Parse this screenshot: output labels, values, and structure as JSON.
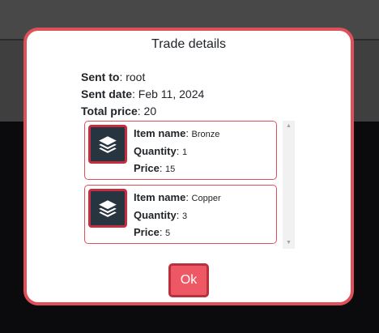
{
  "modal": {
    "title": "Trade details",
    "sent_to_label": "Sent to",
    "sent_to_value": "root",
    "sent_date_label": "Sent date",
    "sent_date_value": "Feb 11, 2024",
    "total_price_label": "Total price",
    "total_price_value": "20",
    "items": [
      {
        "name_label": "Item name",
        "name": "Bronze",
        "quantity_label": "Quantity",
        "quantity": "1",
        "price_label": "Price",
        "price": "15",
        "icon": "layers-icon"
      },
      {
        "name_label": "Item name",
        "name": "Copper",
        "quantity_label": "Quantity",
        "quantity": "3",
        "price_label": "Price",
        "price": "5",
        "icon": "layers-icon"
      }
    ],
    "ok_label": "Ok"
  },
  "colors": {
    "accent": "#e0505b",
    "button": "#ee5865",
    "icon_bg": "#273540"
  }
}
